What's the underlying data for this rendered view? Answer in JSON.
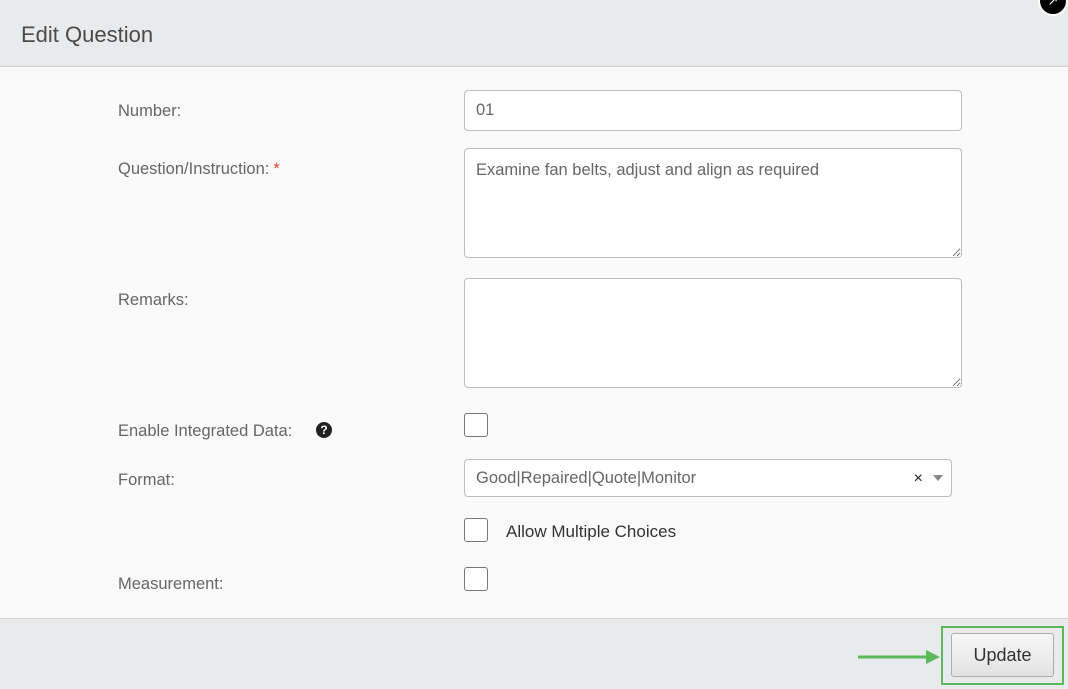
{
  "dialog": {
    "title": "Edit Question",
    "close_icon": "close-icon"
  },
  "form": {
    "number": {
      "label": "Number:",
      "value": "01"
    },
    "question": {
      "label": "Question/Instruction:",
      "required_mark": "*",
      "value": "Examine fan belts, adjust and align as required"
    },
    "remarks": {
      "label": "Remarks:",
      "value": ""
    },
    "integrated_data": {
      "label": "Enable Integrated Data:",
      "help_icon": "question-circle-icon",
      "help_glyph": "?",
      "checked": false
    },
    "format": {
      "label": "Format:",
      "selected": "Good|Repaired|Quote|Monitor",
      "clear_glyph": "×"
    },
    "allow_multiple": {
      "label": "Allow Multiple Choices",
      "checked": false
    },
    "measurement": {
      "label": "Measurement:",
      "checked": false
    }
  },
  "footer": {
    "update_label": "Update",
    "annotation_color": "#5cb85c"
  }
}
